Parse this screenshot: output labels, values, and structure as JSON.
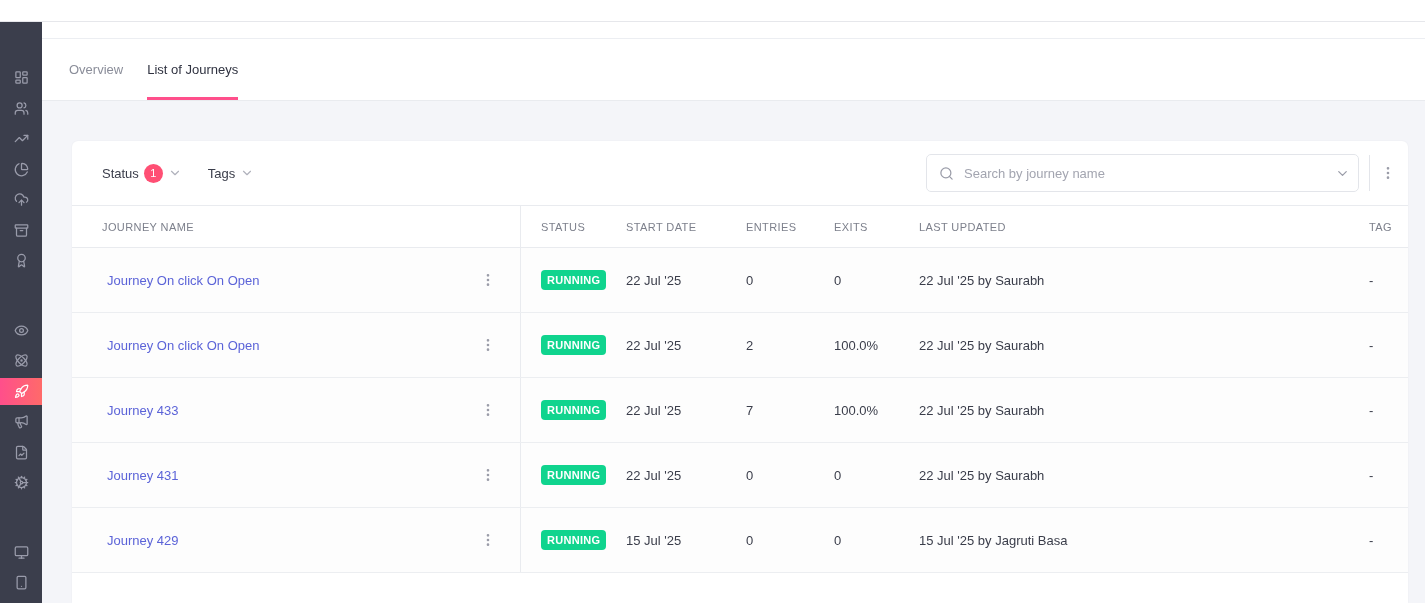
{
  "sidebar": {
    "items": [
      {
        "selected": false
      },
      {
        "selected": false
      },
      {
        "selected": false
      },
      {
        "selected": false
      },
      {
        "selected": false
      },
      {
        "selected": false
      },
      {
        "selected": false
      },
      {
        "selected": false
      },
      {
        "selected": false
      },
      {
        "selected": true
      },
      {
        "selected": false
      },
      {
        "selected": false
      },
      {
        "selected": false
      },
      {
        "selected": false
      },
      {
        "selected": false
      }
    ]
  },
  "tabs": [
    {
      "label": "Overview",
      "selected": false
    },
    {
      "label": "List of Journeys",
      "selected": true
    }
  ],
  "filters": [
    {
      "label": "Status",
      "count": "1"
    },
    {
      "label": "Tags"
    }
  ],
  "search": {
    "placeholder": "Search by journey name"
  },
  "table": {
    "columns": [
      "JOURNEY NAME",
      "STATUS",
      "START DATE",
      "ENTRIES",
      "EXITS",
      "LAST UPDATED",
      "TAG"
    ],
    "rows": [
      {
        "name": "Journey On click On Open",
        "status": "RUNNING",
        "start_date": "22 Jul '25",
        "entries": "0",
        "exits": "0",
        "last_updated": "22 Jul '25 by Saurabh",
        "tags": "-"
      },
      {
        "name": "Journey On click On Open",
        "status": "RUNNING",
        "start_date": "22 Jul '25",
        "entries": "2",
        "exits": "100.0%",
        "last_updated": "22 Jul '25 by Saurabh",
        "tags": "-"
      },
      {
        "name": "Journey 433",
        "status": "RUNNING",
        "start_date": "22 Jul '25",
        "entries": "7",
        "exits": "100.0%",
        "last_updated": "22 Jul '25 by Saurabh",
        "tags": "-"
      },
      {
        "name": "Journey 431",
        "status": "RUNNING",
        "start_date": "22 Jul '25",
        "entries": "0",
        "exits": "0",
        "last_updated": "22 Jul '25 by Saurabh",
        "tags": "-"
      },
      {
        "name": "Journey 429",
        "status": "RUNNING",
        "start_date": "15 Jul '25",
        "entries": "0",
        "exits": "0",
        "last_updated": "15 Jul '25 by Jagruti Basa",
        "tags": "-"
      }
    ]
  }
}
